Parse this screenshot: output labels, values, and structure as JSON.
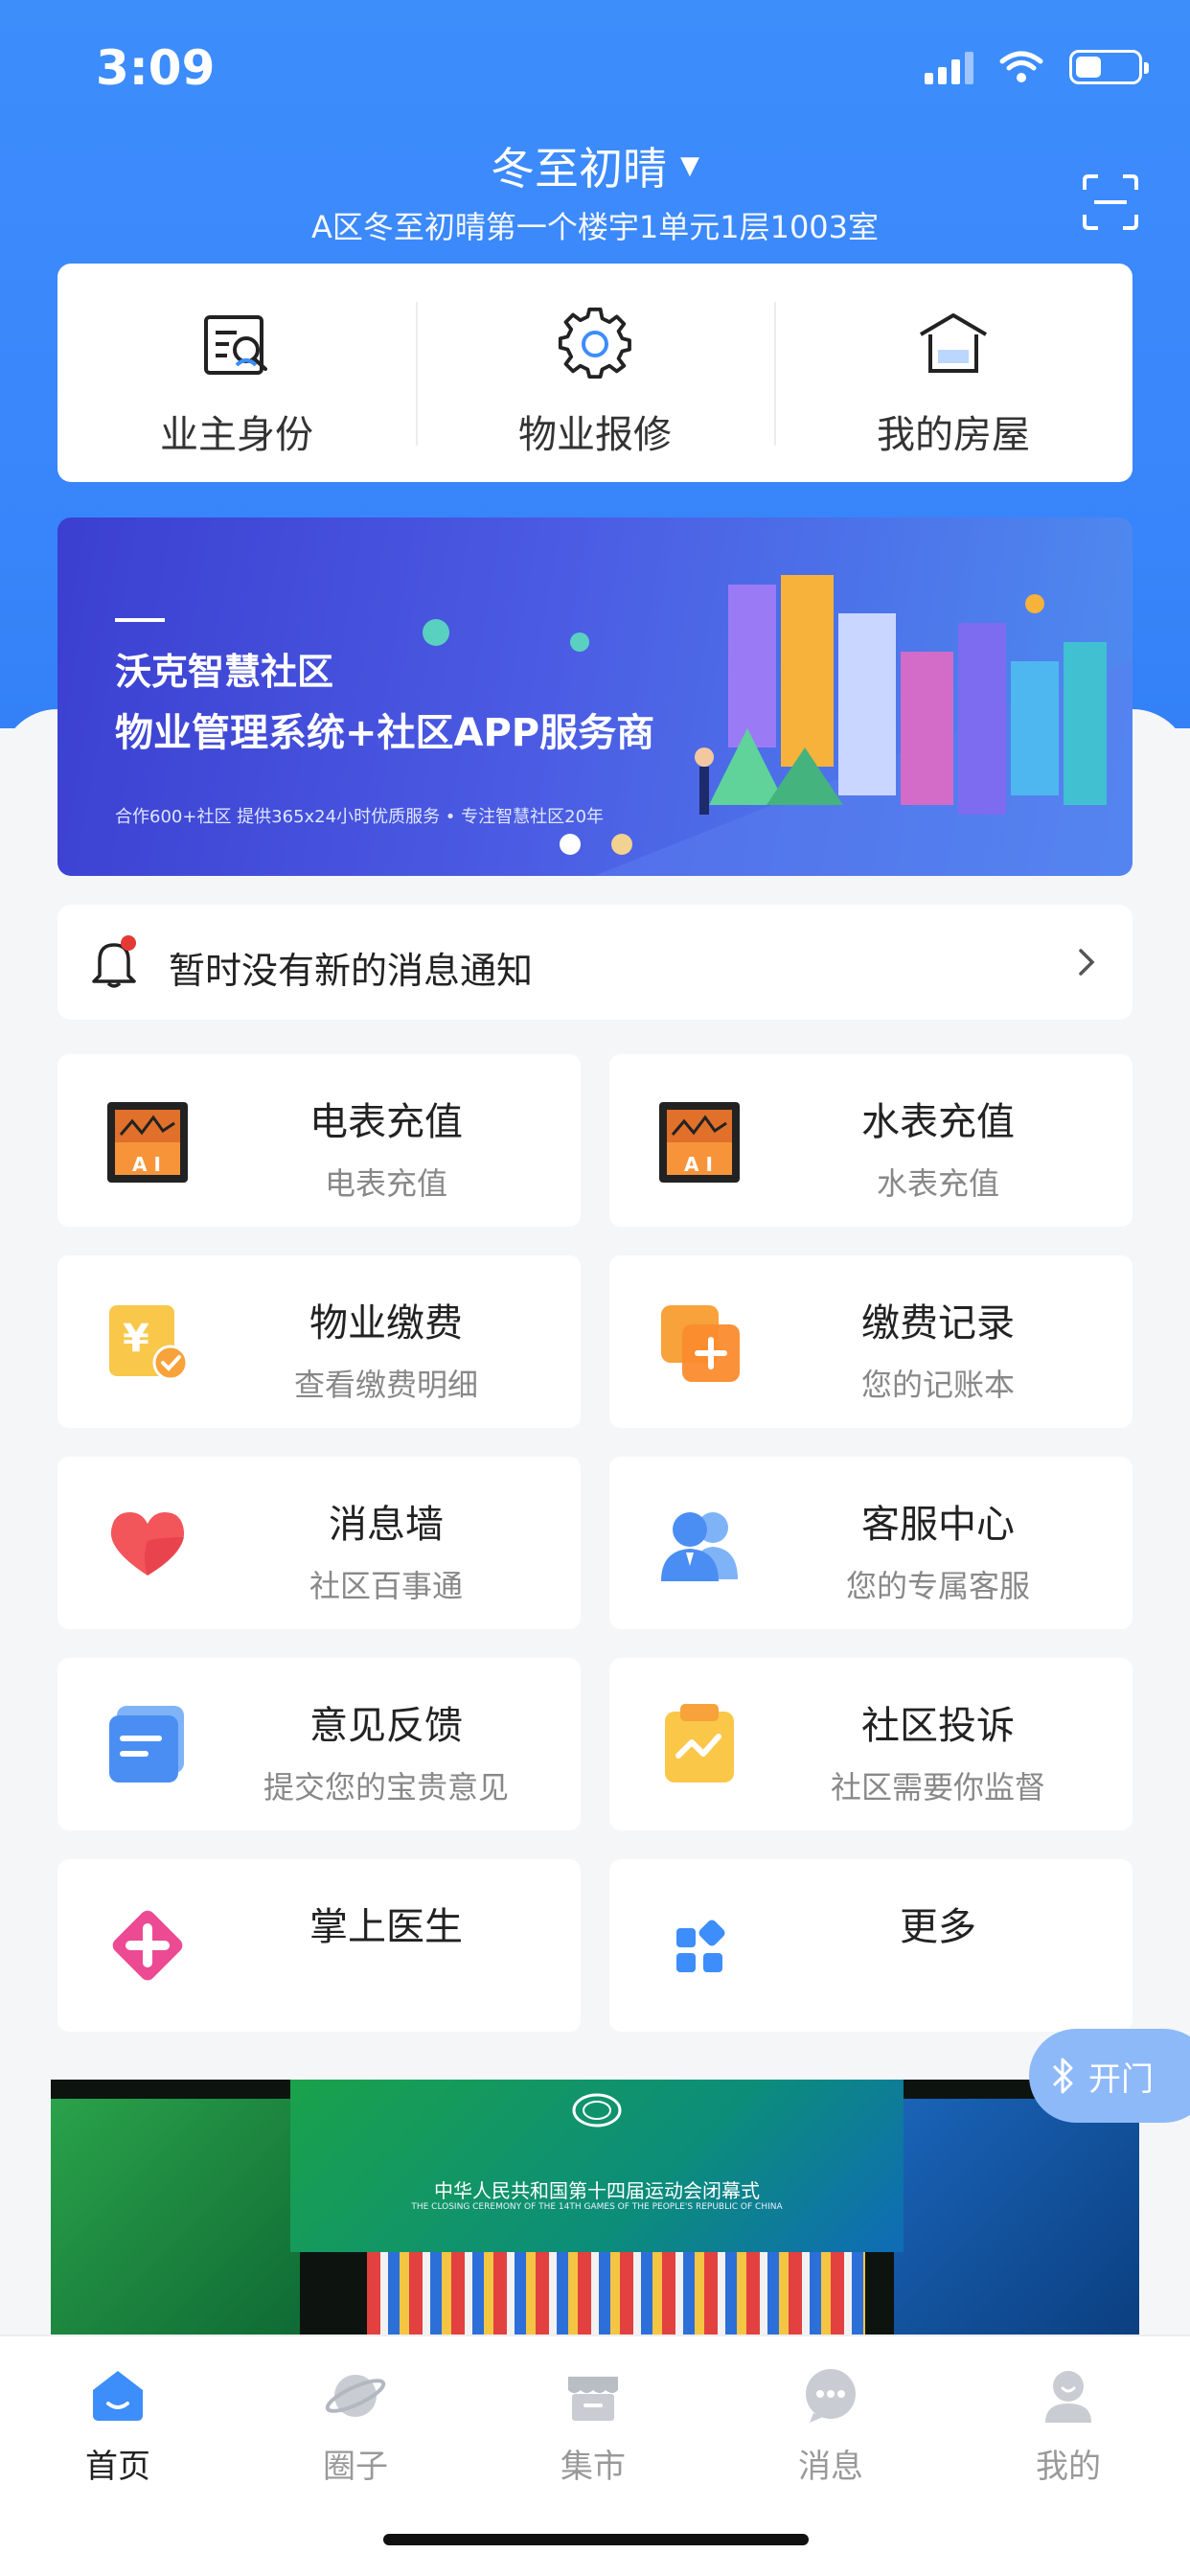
{
  "status_bar": {
    "time": "3:09",
    "battery_level_pct": 40
  },
  "header": {
    "community_name": "冬至初晴",
    "address": "A区冬至初晴第一个楼宇1单元1层1003室"
  },
  "quick_actions": [
    {
      "label": "业主身份",
      "icon": "id-card-icon"
    },
    {
      "label": "物业报修",
      "icon": "gear-icon"
    },
    {
      "label": "我的房屋",
      "icon": "house-icon"
    }
  ],
  "banner": {
    "title": "沃克智慧社区",
    "subtitle": "物业管理系统+社区APP服务商",
    "tagline": "合作600+社区  提供365x24小时优质服务  •  专注智慧社区20年",
    "slide_count": 2,
    "active_slide": 1
  },
  "notice": {
    "text": "暂时没有新的消息通知"
  },
  "services": [
    {
      "title": "电表充值",
      "subtitle": "电表充值",
      "icon": "meter-icon"
    },
    {
      "title": "水表充值",
      "subtitle": "水表充值",
      "icon": "meter-icon"
    },
    {
      "title": "物业缴费",
      "subtitle": "查看缴费明细",
      "icon": "yen-check-icon"
    },
    {
      "title": "缴费记录",
      "subtitle": "您的记账本",
      "icon": "record-plus-icon"
    },
    {
      "title": "消息墙",
      "subtitle": "社区百事通",
      "icon": "heart-icon"
    },
    {
      "title": "客服中心",
      "subtitle": "您的专属客服",
      "icon": "customer-service-icon"
    },
    {
      "title": "意见反馈",
      "subtitle": "提交您的宝贵意见",
      "icon": "feedback-icon"
    },
    {
      "title": "社区投诉",
      "subtitle": "社区需要你监督",
      "icon": "clipboard-icon"
    },
    {
      "title": "掌上医生",
      "subtitle": "",
      "icon": "medical-cross-icon"
    },
    {
      "title": "更多",
      "subtitle": "",
      "icon": "grid-icon"
    }
  ],
  "open_door": {
    "label": "开门"
  },
  "video": {
    "title": "中华人民共和国第十四届运动会闭幕式",
    "subtitle": "THE CLOSING CEREMONY OF THE 14TH GAMES OF THE PEOPLE'S REPUBLIC OF CHINA"
  },
  "tabs": [
    {
      "label": "首页",
      "active": true
    },
    {
      "label": "圈子",
      "active": false
    },
    {
      "label": "集市",
      "active": false
    },
    {
      "label": "消息",
      "active": false
    },
    {
      "label": "我的",
      "active": false
    }
  ],
  "colors": {
    "primary": "#3d8dfb",
    "accent_orange": "#f7a23a",
    "notice_dot": "#e53935"
  }
}
